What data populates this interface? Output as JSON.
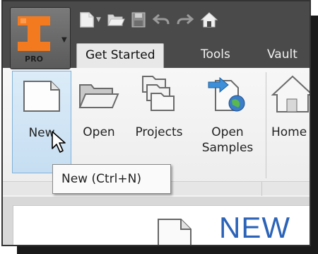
{
  "app": {
    "badge": "PRO",
    "accent_color": "#f47a20"
  },
  "quick_access": [
    {
      "name": "new-icon"
    },
    {
      "name": "dropdown-arrow-icon"
    },
    {
      "name": "open-folder-icon"
    },
    {
      "name": "save-icon"
    },
    {
      "name": "undo-icon"
    },
    {
      "name": "redo-icon"
    },
    {
      "name": "home-icon"
    }
  ],
  "tabs": [
    {
      "label": "Get Started",
      "active": true
    },
    {
      "label": "Tools",
      "active": false
    },
    {
      "label": "Vault",
      "active": false
    }
  ],
  "ribbon": {
    "new": {
      "label": "New",
      "highlighted": true
    },
    "open": {
      "label": "Open"
    },
    "projects": {
      "label": "Projects"
    },
    "open_samples": {
      "label": "Open\nSamples"
    },
    "home": {
      "label": "Home"
    }
  },
  "tooltip": {
    "text": "New (Ctrl+N)"
  },
  "content": {
    "heading": "NEW"
  }
}
